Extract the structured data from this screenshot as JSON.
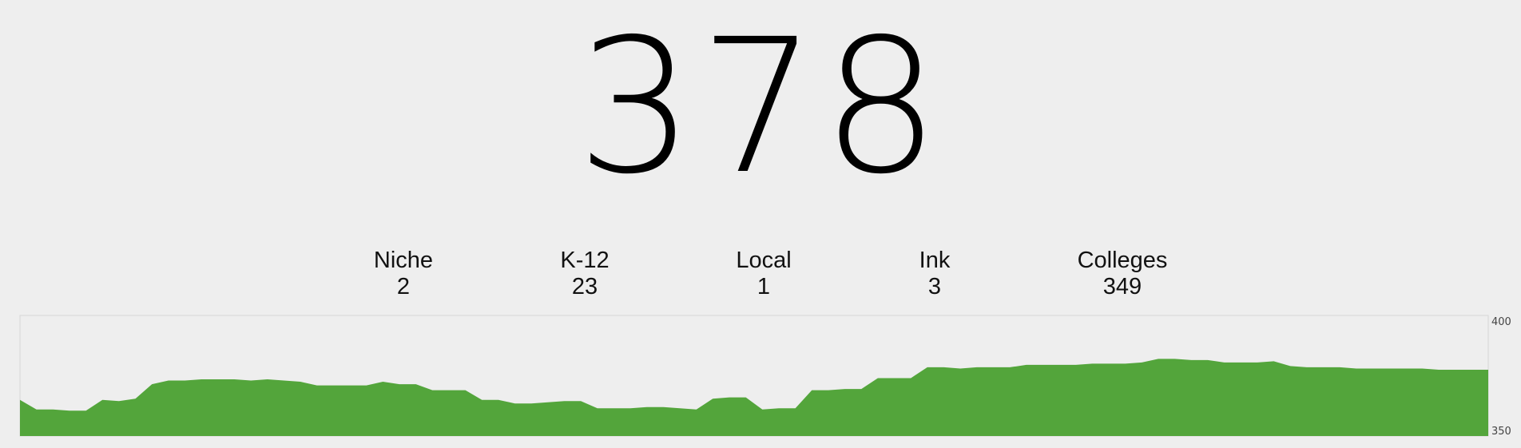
{
  "total": "378",
  "categories": [
    {
      "label": "Niche",
      "value": "2"
    },
    {
      "label": "K-12",
      "value": "23"
    },
    {
      "label": "Local",
      "value": "1"
    },
    {
      "label": "Ink",
      "value": "3"
    },
    {
      "label": "Colleges",
      "value": "349"
    }
  ],
  "chart_data": {
    "type": "area",
    "title": "",
    "xlabel": "",
    "ylabel": "",
    "ylim": [
      350,
      400
    ],
    "yticks": [
      "400",
      "350"
    ],
    "grid": false,
    "color": "#53a53b",
    "background": "#eeeeee",
    "series": [
      {
        "values": [
          365,
          361,
          361,
          360.5,
          360.5,
          365,
          364.5,
          365.5,
          371.5,
          373,
          373,
          373.5,
          373.5,
          373.5,
          373,
          373.5,
          373,
          372.5,
          371,
          371,
          371,
          371,
          372.5,
          371.5,
          371.5,
          369,
          369,
          369,
          365,
          365,
          363.5,
          363.5,
          364,
          364.5,
          364.5,
          361.5,
          361.5,
          361.5,
          362,
          362,
          361.5,
          361,
          365.5,
          366,
          366,
          361,
          361.5,
          361.5,
          369,
          369,
          369.5,
          369.5,
          374,
          374,
          374,
          378.5,
          378.5,
          378,
          378.5,
          378.5,
          378.5,
          379.5,
          379.5,
          379.5,
          379.5,
          380,
          380,
          380,
          380.5,
          382,
          382,
          381.5,
          381.5,
          380.5,
          380.5,
          380.5,
          381,
          379,
          378.5,
          378.5,
          378.5,
          378,
          378,
          378,
          378,
          378,
          377.5,
          377.5,
          377.5,
          377.5
        ]
      }
    ]
  }
}
